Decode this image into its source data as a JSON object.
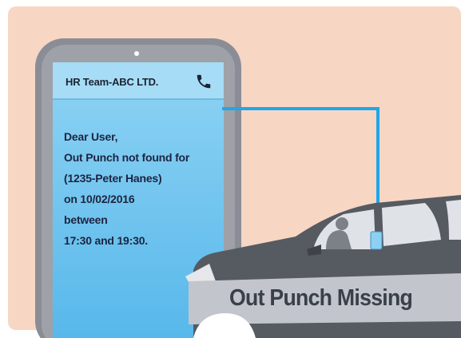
{
  "phone": {
    "header_title": "HR Team-ABC LTD.",
    "header_icon": "phone-icon"
  },
  "message": {
    "lines": [
      "Dear User,",
      "Out Punch not found for",
      "(1235-Peter Hanes)",
      "on 10/02/2016",
      "between",
      "17:30 and 19:30."
    ]
  },
  "banner": {
    "title": "Out Punch Missing"
  },
  "colors": {
    "background": "#f7d6c4",
    "phone_body": "#8a8d95",
    "screen": "#6cc3ee",
    "connector": "#1fa7e8",
    "car": "#565a61"
  }
}
